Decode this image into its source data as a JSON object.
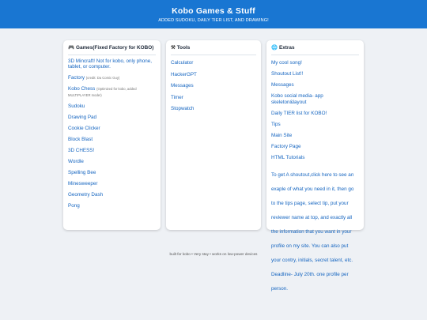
{
  "header": {
    "title": "Kobo Games & Stuff",
    "subtitle": "ADDED SUDOKU, DAILY TIER LIST, AND DRAWING!"
  },
  "games": {
    "icon": "gamepad-icon",
    "title": "Games(Fixed Factory for KOBO)",
    "items": [
      {
        "label": "3D Mincraft! Not for kobo, only phone, tablet, or computer.",
        "note": ""
      },
      {
        "label": "Factory",
        "note": "(credit: Da Comic Guy)"
      },
      {
        "label": "Kobo Chess",
        "note": "(Optimized for kobo, added MULTIPLAYER mode!)"
      },
      {
        "label": "Sudoku",
        "note": ""
      },
      {
        "label": "Drawing Pad",
        "note": ""
      },
      {
        "label": "Cookie Clicker",
        "note": ""
      },
      {
        "label": "Block Blast",
        "note": ""
      },
      {
        "label": "3D CHESS!",
        "note": ""
      },
      {
        "label": "Wordle",
        "note": ""
      },
      {
        "label": "Spelling Bee",
        "note": ""
      },
      {
        "label": "Minesweeper",
        "note": ""
      },
      {
        "label": "Geometry Dash",
        "note": ""
      },
      {
        "label": "Pong",
        "note": ""
      }
    ]
  },
  "tools": {
    "icon": "tools-icon",
    "title": "Tools",
    "items": [
      "Calculator",
      "HackerGPT",
      "Messages",
      "Timer",
      "Stopwatch"
    ]
  },
  "extras": {
    "icon": "globe-icon",
    "title": "Extras",
    "items": [
      "My cool song!",
      "Shoutout List!!",
      "Messages",
      "Kobo social media- app skeleton&layout",
      "Daily TIER list for KOBO!",
      "Tips",
      "Main Site",
      "Factory Page",
      "HTML Tutorials"
    ],
    "shoutout_text": "To get A shoutout,click here to see an exaple of what you need in it, then go to the tips page, select tip, put your reviewer name at top, and exactly all the information that you want in your profile on my site. You can also put your contry, initials, secret talent, etc. Deadline- July 20th. one profile per person."
  },
  "footer": "built for kobo • Very stay • works on low-power devices",
  "colors": {
    "header": "#1976d2",
    "link": "#1565c0",
    "background": "#eef1f5"
  }
}
